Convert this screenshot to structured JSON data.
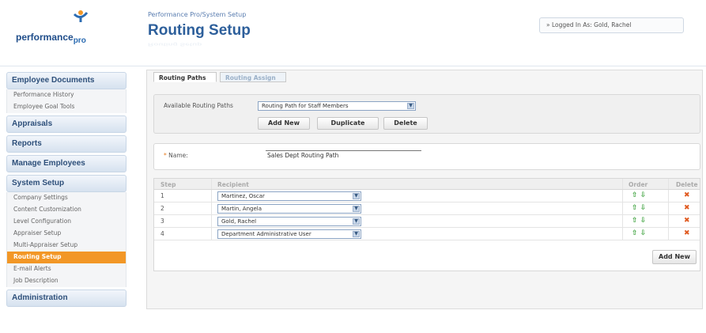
{
  "header": {
    "logo_text": "performance",
    "logo_sub": "pro",
    "breadcrumb": "Performance Pro/System Setup",
    "title": "Routing Setup",
    "login_status": "» Logged In As: Gold, Rachel"
  },
  "sidebar": {
    "sections": [
      {
        "label": "Employee Documents",
        "items": [
          "Performance History",
          "Employee Goal Tools"
        ]
      },
      {
        "label": "Appraisals",
        "items": []
      },
      {
        "label": "Reports",
        "items": []
      },
      {
        "label": "Manage Employees",
        "items": []
      },
      {
        "label": "System Setup",
        "items": [
          "Company Settings",
          "Content Customization",
          "Level Configuration",
          "Appraiser Setup",
          "Multi-Appraiser Setup",
          "Routing Setup",
          "E-mail Alerts",
          "Job Description"
        ]
      },
      {
        "label": "Administration",
        "items": []
      }
    ],
    "active_item": "Routing Setup"
  },
  "tabs": [
    {
      "label": "Routing Paths",
      "active": true
    },
    {
      "label": "Routing Assign",
      "active": false
    }
  ],
  "paths": {
    "label": "Available Routing Paths",
    "selected": "Routing Path for Staff Members",
    "buttons": {
      "add_new": "Add New",
      "duplicate": "Duplicate",
      "delete": "Delete"
    }
  },
  "name_field": {
    "required_mark": "*",
    "label": "Name:",
    "value": "Sales Dept Routing Path"
  },
  "table": {
    "headers": {
      "step": "Step",
      "recipient": "Recipient",
      "order": "Order",
      "delete": "Delete"
    },
    "rows": [
      {
        "step": "1",
        "recipient": "Martinez, Oscar"
      },
      {
        "step": "2",
        "recipient": "Martin, Angela"
      },
      {
        "step": "3",
        "recipient": "Gold, Rachel"
      },
      {
        "step": "4",
        "recipient": "Department Administrative User"
      }
    ],
    "add_new": "Add New"
  },
  "colors": {
    "accent": "#f29726",
    "title": "#2d5f9b",
    "order_arrows": "#3aa03a",
    "delete_x": "#e05a20"
  }
}
